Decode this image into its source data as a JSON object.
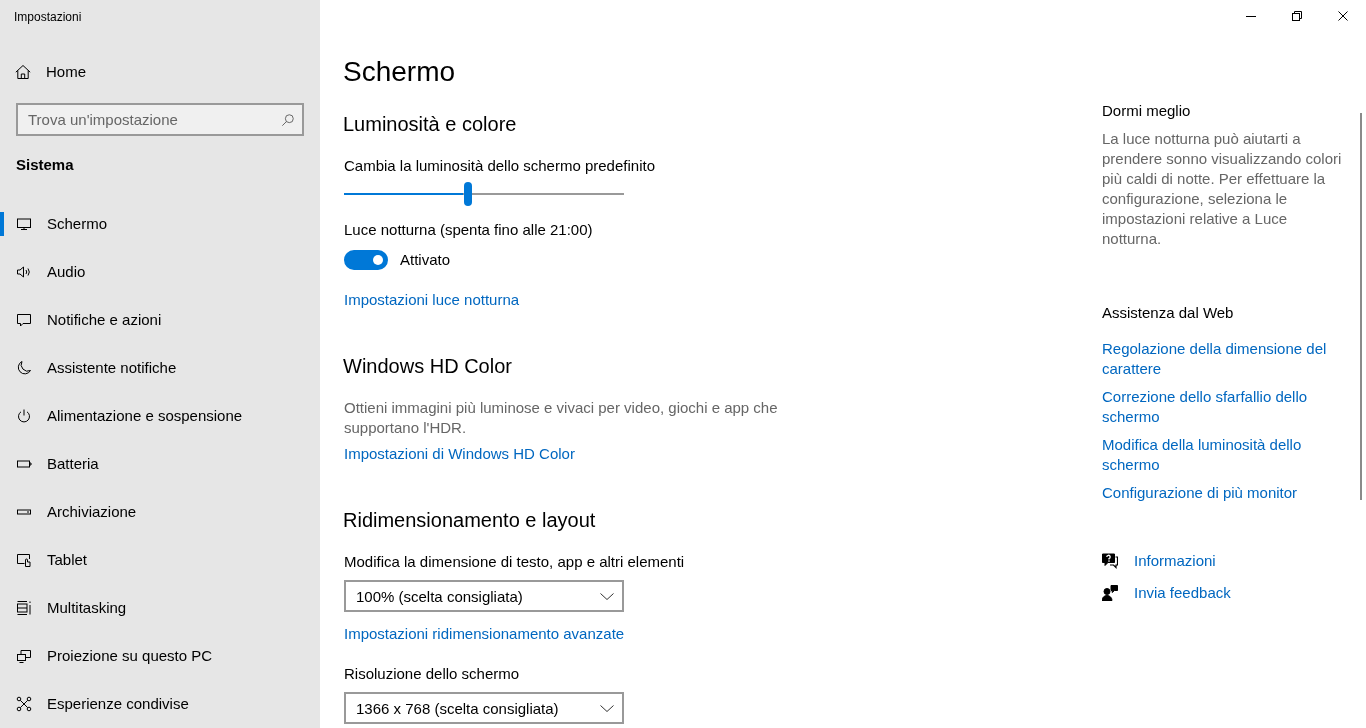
{
  "window": {
    "title": "Impostazioni"
  },
  "sidebar": {
    "home": {
      "label": "Home"
    },
    "search": {
      "placeholder": "Trova un'impostazione"
    },
    "section": "Sistema",
    "items": [
      {
        "label": "Schermo",
        "selected": true
      },
      {
        "label": "Audio",
        "selected": false
      },
      {
        "label": "Notifiche e azioni",
        "selected": false
      },
      {
        "label": "Assistente notifiche",
        "selected": false
      },
      {
        "label": "Alimentazione e sospensione",
        "selected": false
      },
      {
        "label": "Batteria",
        "selected": false
      },
      {
        "label": "Archiviazione",
        "selected": false
      },
      {
        "label": "Tablet",
        "selected": false
      },
      {
        "label": "Multitasking",
        "selected": false
      },
      {
        "label": "Proiezione su questo PC",
        "selected": false
      },
      {
        "label": "Esperienze condivise",
        "selected": false
      }
    ]
  },
  "page": {
    "title": "Schermo",
    "sections": [
      {
        "heading": "Luminosità e colore",
        "items": [
          {
            "kind": "slider",
            "label": "Cambia la luminosità dello schermo predefinito",
            "level": 0.44
          },
          {
            "kind": "toggle",
            "label": "Luce notturna (spenta fino alle 21:00)",
            "on": true,
            "state_text": "Attivato"
          },
          {
            "kind": "link",
            "label": "Impostazioni luce notturna"
          }
        ]
      },
      {
        "heading": "Windows HD Color",
        "items": [
          {
            "kind": "text",
            "text": "Ottieni immagini più luminose e vivaci per video, giochi e app che supportano l'HDR."
          },
          {
            "kind": "link",
            "label": "Impostazioni di Windows HD Color"
          }
        ]
      },
      {
        "heading": "Ridimensionamento e layout",
        "items": [
          {
            "kind": "dropdown",
            "label": "Modifica la dimensione di testo, app e altri elementi",
            "value": "100% (scelta consigliata)"
          },
          {
            "kind": "link",
            "label": "Impostazioni ridimensionamento avanzate"
          },
          {
            "kind": "dropdown",
            "label": "Risoluzione dello schermo",
            "value": "1366 x 768 (scelta consigliata)"
          }
        ]
      }
    ]
  },
  "aside": {
    "info": {
      "heading": "Dormi meglio",
      "text": "La luce notturna può aiutarti a prendere sonno visualizzando colori più caldi di notte. Per effettuare la configurazione, seleziona le impostazioni relative a Luce notturna."
    },
    "help": {
      "heading": "Assistenza dal Web",
      "links": [
        "Regolazione della dimensione del carattere",
        "Correzione dello sfarfallio dello schermo",
        "Modifica della luminosità dello schermo",
        "Configurazione di più monitor"
      ]
    },
    "actions": [
      {
        "label": "Informazioni"
      },
      {
        "label": "Invia feedback"
      }
    ]
  }
}
